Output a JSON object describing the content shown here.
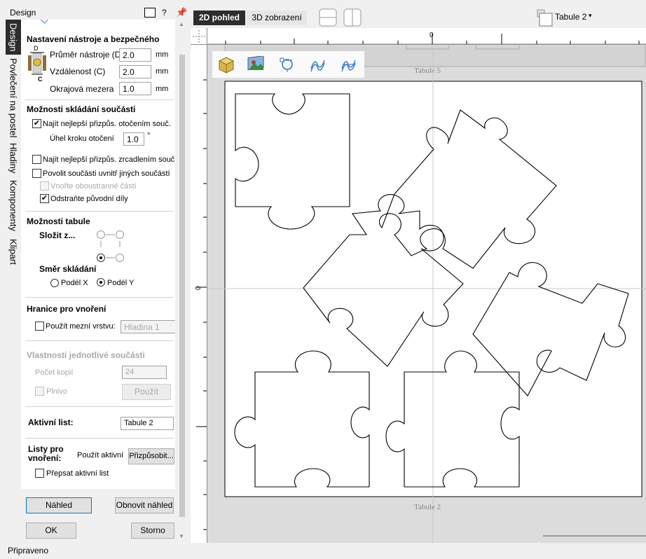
{
  "panel": {
    "title": "Design",
    "help": "?",
    "vtabs": [
      "Design",
      "Povlečení na postel",
      "Hladiny",
      "Komponenty",
      "Klipart"
    ],
    "tool_section": {
      "title": "Nastavení nástroje a bezpečného",
      "diagram_d": "D",
      "diagram_c": "C",
      "fields": [
        {
          "label": "Průměr nástroje (D)",
          "value": "2.0",
          "unit": "mm"
        },
        {
          "label": "Vzdálenost (C)",
          "value": "2.0",
          "unit": "mm"
        },
        {
          "label": "Okrajová mezera",
          "value": "1.0",
          "unit": "mm"
        }
      ]
    },
    "nest_section": {
      "title": "Možnosti skládání součásti",
      "rotate_label": "Najít nejlepší přizpůs. otočením souč.",
      "rotate_checked": true,
      "angle_label": "Úhel kroku otočení",
      "angle_value": "1.0",
      "angle_unit": "°",
      "mirror_label": "Najít nejlepší přizpůs. zrcadlením souč.",
      "inside_label": "Povolit součásti uvnitř jiných součástí",
      "double_label": "Vnořte oboustranné části",
      "remove_label": "Odstraňte původní díly",
      "remove_checked": true
    },
    "sheet_section": {
      "title": "Možnosti tabule",
      "compose_label": "Složit z...",
      "direction_label": "Směr skládání",
      "along_x": "Podél X",
      "along_y": "Podél Y",
      "selected": "Podél Y"
    },
    "boundary_section": {
      "title": "Hranice pro vnoření",
      "use_layer_label": "Použít mezní vrstvu:",
      "layer_value": "Hladina 1"
    },
    "part_section": {
      "title": "Vlastnosti jednotlivé součásti",
      "copies_label": "Počet kopií",
      "copies_value": "24",
      "fill_label": "Plnivo",
      "apply_label": "Použít"
    },
    "active_sheet": {
      "label": "Aktivní list:",
      "value": "Tabule 2"
    },
    "nest_sheets": {
      "label": "Listy pro vnoření:",
      "use_active_label": "Použít aktivní",
      "fit_value": "Přizpůsobit...",
      "overwrite_label": "Přepsat aktivní list"
    },
    "buttons": {
      "preview": "Náhled",
      "refresh_preview": "Obnovit náhled",
      "ok": "OK",
      "cancel": "Storno"
    }
  },
  "view": {
    "tab_2d": "2D pohled",
    "tab_3d": "3D zobrazení",
    "sheet_selector": "Tabule 2",
    "ruler_zero": "0",
    "sheet_above_label": "Tabule 5",
    "sheet_label": "Tabule 2"
  },
  "status": {
    "text": "Připraveno"
  },
  "colors": {
    "accent": "#2d2d2d",
    "focus": "#0078d7",
    "canvas_bg": "#dcdcdc"
  },
  "icons": [
    "box-3d-icon",
    "image-icon",
    "node-edit-icon",
    "wave-icon",
    "wave-hatch-icon",
    "split-horizontal-icon",
    "split-vertical-icon",
    "sheet-icon",
    "pin-icon"
  ]
}
